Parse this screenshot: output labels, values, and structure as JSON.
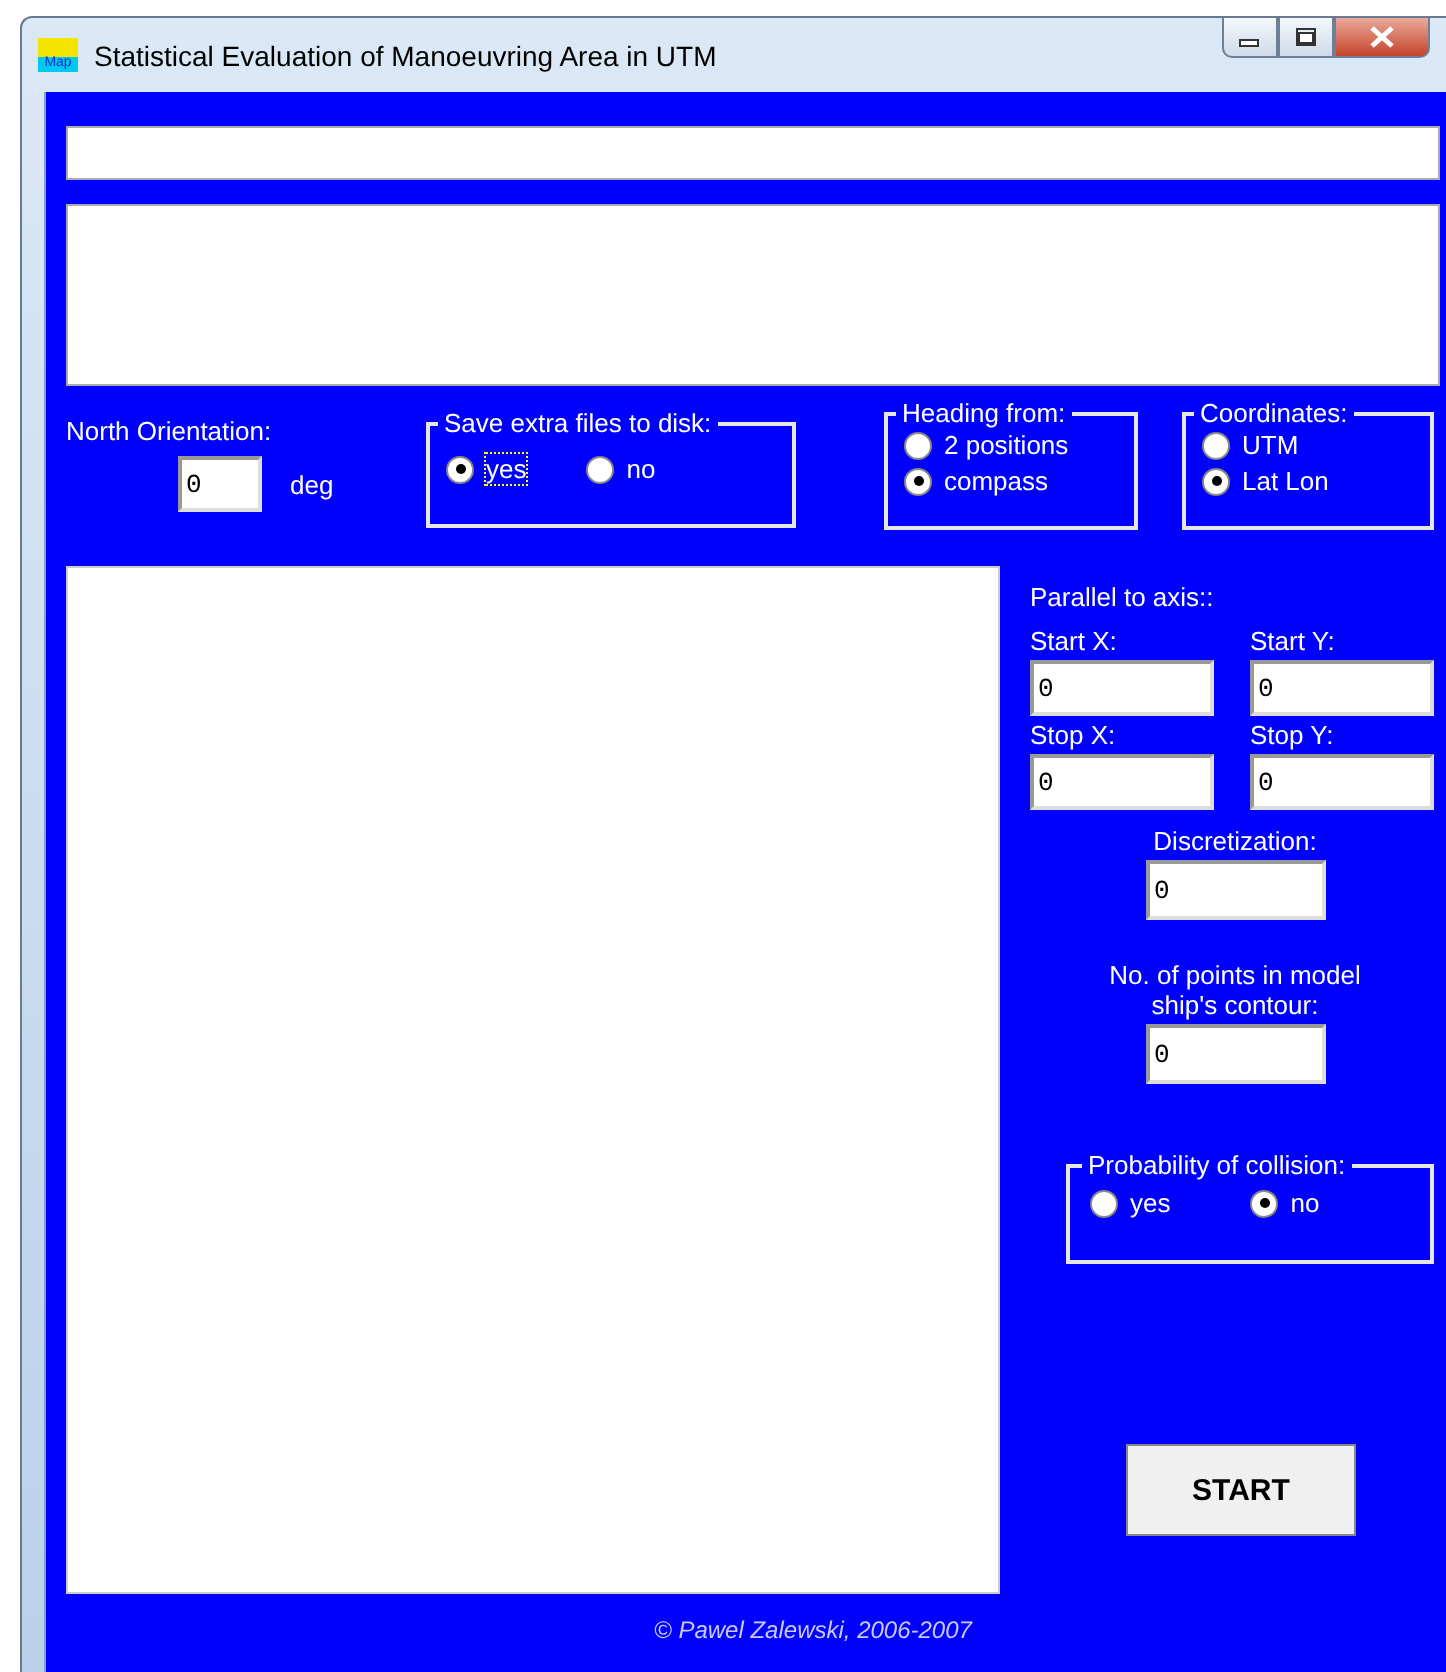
{
  "window": {
    "title": "Statistical Evaluation of Manoeuvring Area in UTM",
    "icon_text": "Map"
  },
  "north_orientation": {
    "label": "North Orientation:",
    "value": "0",
    "unit": "deg"
  },
  "groups": [
    {
      "kind": "save",
      "legend": "Save extra files to disk:",
      "options": [
        {
          "label": "yes",
          "selected": true,
          "focused": true
        },
        {
          "label": "no",
          "selected": false,
          "focused": false
        }
      ]
    },
    {
      "kind": "heading",
      "legend": "Heading from:",
      "options": [
        {
          "label": "2 positions",
          "selected": false,
          "focused": false
        },
        {
          "label": "compass",
          "selected": true,
          "focused": false
        }
      ]
    },
    {
      "kind": "coords",
      "legend": "Coordinates:",
      "options": [
        {
          "label": "UTM",
          "selected": false,
          "focused": false
        },
        {
          "label": "Lat Lon",
          "selected": true,
          "focused": false
        }
      ]
    }
  ],
  "parallel_to_axis": {
    "label": "Parallel to axis::",
    "fields": [
      {
        "label": "Start X:",
        "value": "0"
      },
      {
        "label": "Start Y:",
        "value": "0"
      },
      {
        "label": "Stop X:",
        "value": "0"
      },
      {
        "label": "Stop Y:",
        "value": "0"
      }
    ]
  },
  "discretization": {
    "label": "Discretization:",
    "value": "0"
  },
  "contour_points": {
    "label": "No. of points in model ship's contour:",
    "value": "0"
  },
  "probability_of_collision": {
    "legend": "Probability of collision:",
    "options": [
      {
        "label": "yes",
        "selected": false,
        "focused": false
      },
      {
        "label": "no",
        "selected": true,
        "focused": false
      }
    ]
  },
  "start_button": "START",
  "copyright": "© Pawel Zalewski, 2006-2007"
}
